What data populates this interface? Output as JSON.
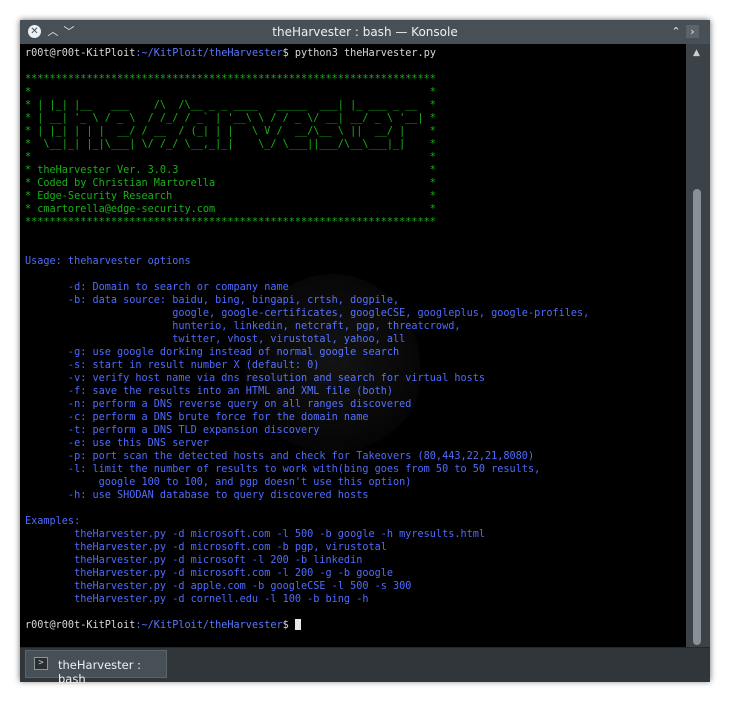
{
  "window": {
    "title": "theHarvester : bash — Konsole"
  },
  "colors": {
    "titlebar": "#475057",
    "terminal_bg": "#000000",
    "banner_green": "#18b218",
    "usage_blue": "#4f6bff",
    "prompt_white": "#d8d8d8"
  },
  "icons": {
    "close": "close-icon",
    "shade": "chevron-up-icon",
    "menu": "chevron-down-icon",
    "keep_above": "double-chevron-up-icon",
    "terminal": "terminal-icon"
  },
  "prompt": {
    "user_host": "r00t@r00t-KitPloit",
    "path": ":~/KitPloit/theHarvester",
    "symbol": "$ ",
    "command": "python3 theHarvester.py"
  },
  "banner": [
    "*******************************************************************",
    "*                                                                 *",
    "* | |_| |__   ___    /\\  /\\__ _ _ ____   _____  ___| |_ ___ _ __  *",
    "* | __| '_ \\ / _ \\  / /_/ / _` | '__\\ \\ / / _ \\/ __| __/ _ \\ '__| *",
    "* | |_| | | |  __/ / __  / (_| | |   \\ V /  __/\\__ \\ ||  __/ |    *",
    "*  \\__|_| |_|\\___| \\/ /_/ \\__,_|_|    \\_/ \\___||___/\\__\\___|_|    *",
    "*                                                                 *",
    "* theHarvester Ver. 3.0.3                                         *",
    "* Coded by Christian Martorella                                   *",
    "* Edge-Security Research                                          *",
    "* cmartorella@edge-security.com                                   *",
    "*******************************************************************"
  ],
  "usage": {
    "header": "Usage: theharvester options",
    "options": [
      "       -d: Domain to search or company name",
      "       -b: data source: baidu, bing, bingapi, crtsh, dogpile,",
      "                        google, google-certificates, googleCSE, googleplus, google-profiles,",
      "                        hunterio, linkedin, netcraft, pgp, threatcrowd,",
      "                        twitter, vhost, virustotal, yahoo, all",
      "       -g: use google dorking instead of normal google search",
      "       -s: start in result number X (default: 0)",
      "       -v: verify host name via dns resolution and search for virtual hosts",
      "       -f: save the results into an HTML and XML file (both)",
      "       -n: perform a DNS reverse query on all ranges discovered",
      "       -c: perform a DNS brute force for the domain name",
      "       -t: perform a DNS TLD expansion discovery",
      "       -e: use this DNS server",
      "       -p: port scan the detected hosts and check for Takeovers (80,443,22,21,8080)",
      "       -l: limit the number of results to work with(bing goes from 50 to 50 results,",
      "            google 100 to 100, and pgp doesn't use this option)",
      "       -h: use SHODAN database to query discovered hosts"
    ]
  },
  "examples": {
    "header": "Examples:",
    "lines": [
      "        theHarvester.py -d microsoft.com -l 500 -b google -h myresults.html",
      "        theHarvester.py -d microsoft.com -b pgp, virustotal",
      "        theHarvester.py -d microsoft -l 200 -b linkedin",
      "        theHarvester.py -d microsoft.com -l 200 -g -b google",
      "        theHarvester.py -d apple.com -b googleCSE -l 500 -s 300",
      "        theHarvester.py -d cornell.edu -l 100 -b bing -h"
    ]
  },
  "tab": {
    "label": "theHarvester : bash"
  }
}
